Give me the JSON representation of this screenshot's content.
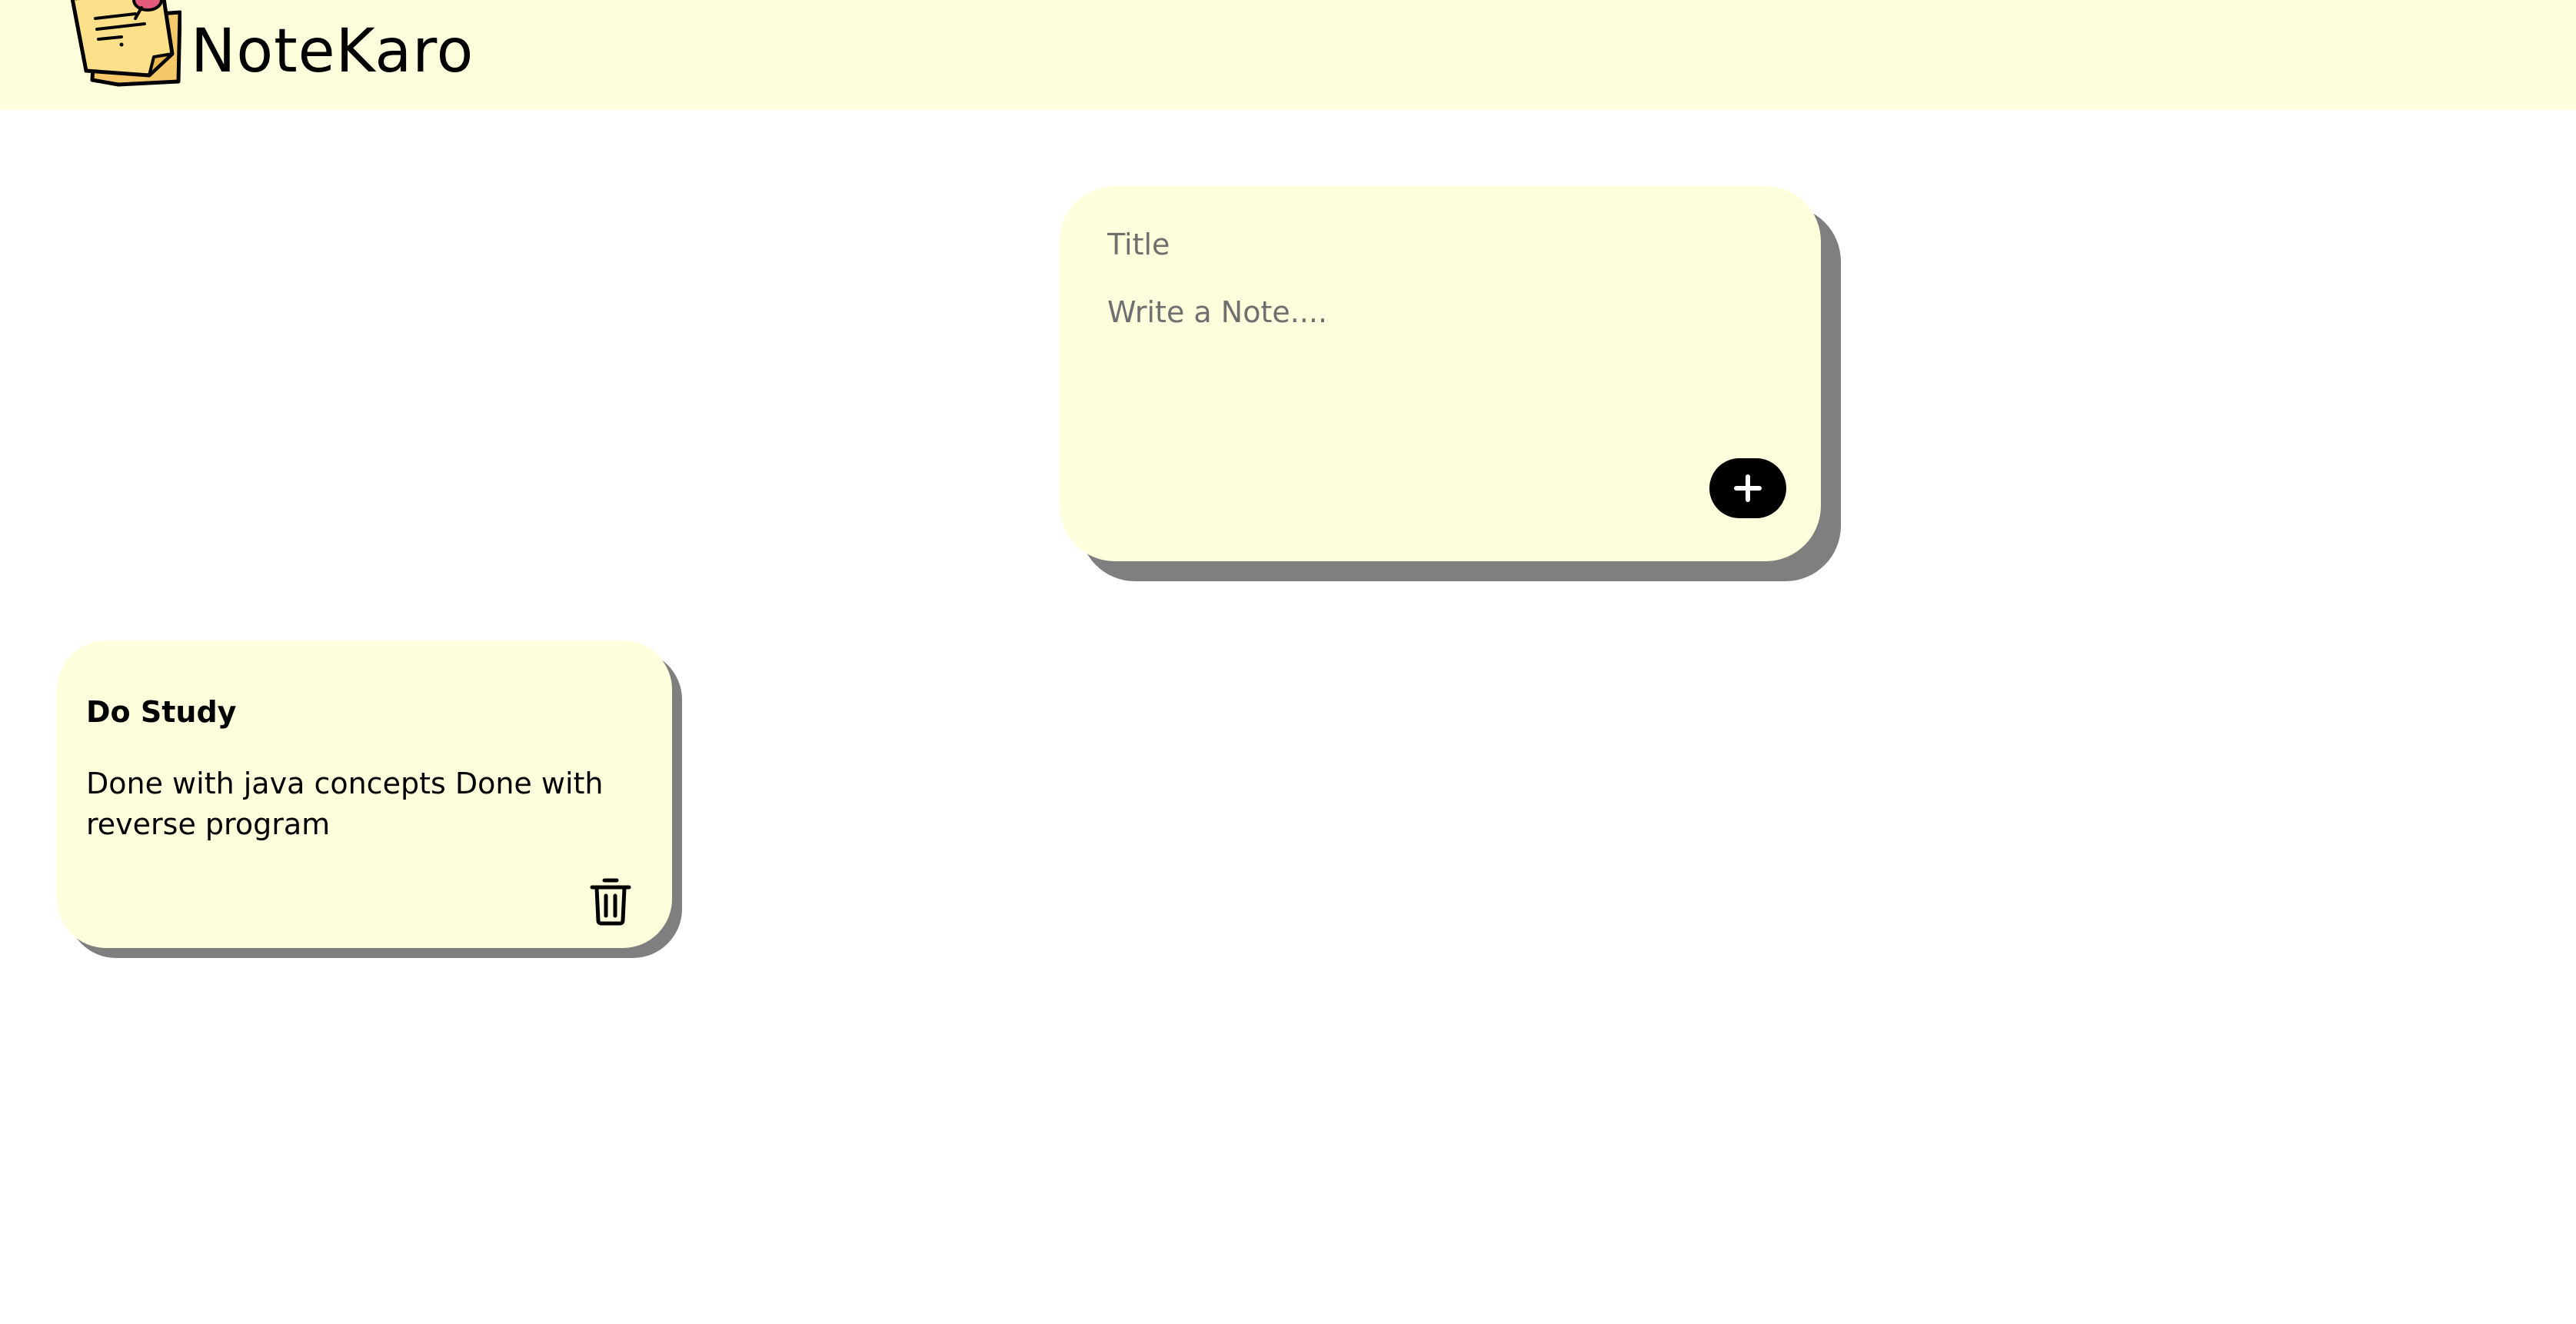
{
  "header": {
    "brand": "NoteKaro",
    "logo_icon": "sticky-note-pin-icon",
    "background_color": "#fffedc"
  },
  "composer": {
    "title_placeholder": "Title",
    "body_placeholder": "Write a Note....",
    "title_value": "",
    "body_value": "",
    "add_icon": "plus-icon",
    "background_color": "#fffedc",
    "shadow_color": "#7f7f7f"
  },
  "notes": [
    {
      "title": "Do Study",
      "content": "Done with java concepts Done with reverse program",
      "delete_icon": "trash-icon"
    }
  ]
}
